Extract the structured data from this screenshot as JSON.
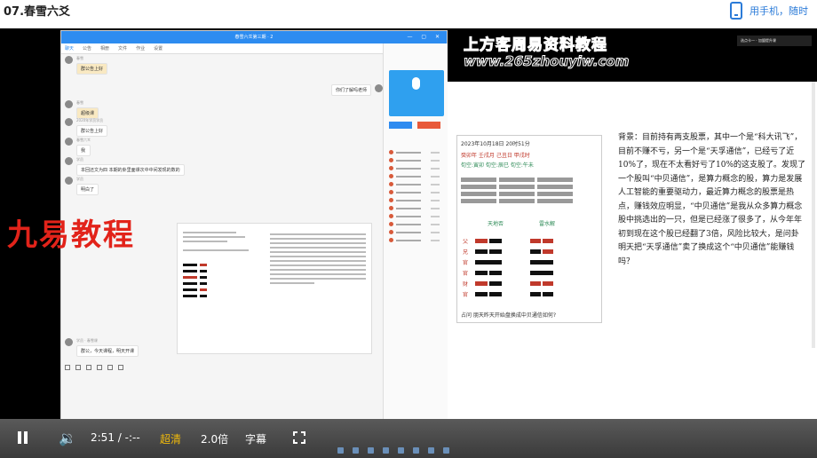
{
  "page": {
    "title": "07.春雪六爻"
  },
  "mobile": {
    "label": "用手机，随时"
  },
  "left_app": {
    "window_title": "春雪六爻第三期 · 2",
    "tabs": [
      "聊天",
      "公告",
      "相册",
      "文件",
      "作业",
      "设置"
    ],
    "messages": [
      {
        "name": "春雪",
        "text": "群公告上好"
      },
      {
        "text": "你们了解吗老师"
      },
      {
        "name": "春雪",
        "text": "超级课"
      },
      {
        "name": "2020年学员学员",
        "text": "群公告上好"
      },
      {
        "name": "春雪六爻",
        "text": "我"
      },
      {
        "name": "学员",
        "text": "本回还文为四  本期的卦里面课次中中间发现的数的"
      },
      {
        "name": "学员",
        "text": "明白了"
      },
      {
        "name": "学员 · 春雪课",
        "text": "群公告上好"
      },
      {
        "text": "群公，今天课程，明天开课"
      }
    ],
    "sidebar_items": [
      "公告老师",
      "语音",
      "内部资料",
      "精选讨论",
      "课件",
      "公告栏",
      "资料",
      "资料库",
      "群文件",
      "课程",
      "直播",
      "公告",
      "群成员"
    ]
  },
  "watermark": {
    "left": "九易教程"
  },
  "right_screen": {
    "watermark_top": "上方客周易资料教程",
    "watermark_url": "www.265zhouyiw.com",
    "window_tag": "选点卡一 · 加盟提升课",
    "chart_header": [
      "2023年10月18日 20时51分",
      "癸卯年 壬戌月 己丑日 甲戌时",
      "旬空:寅卯  旬空:辰巳  旬空:午未"
    ],
    "chart_gua_names": [
      "天地否",
      "雷水解"
    ],
    "chart_question": "占问  朋天昨天开始盘换成中贝通信如何?",
    "hex_lines": [
      "父",
      "兄",
      "官",
      "官",
      "财",
      "官"
    ],
    "context": "背景：目前持有两支股票，其中一个是“科大讯飞”，目前不赚不亏，另一个是“天孚通信”，已经亏了近10%了，现在不太看好亏了10%的这支股了。发现了一个股叫“中贝通信”，是算力概念的股，算力是发展人工智能的重要驱动力，最近算力概念的股票是热点，赚钱效应明显，“中贝通信”是我从众多算力概念股中挑选出的一只，但是已经涨了很多了，从今年年初到现在这个股已经翻了3倍，风险比较大，是问卦明天把“天孚通信”卖了换成这个“中贝通信”能赚钱吗？"
  },
  "controls": {
    "time": "2:51 / -:--",
    "quality": "超清",
    "speed": "2.0倍",
    "subtitle": "字幕"
  }
}
